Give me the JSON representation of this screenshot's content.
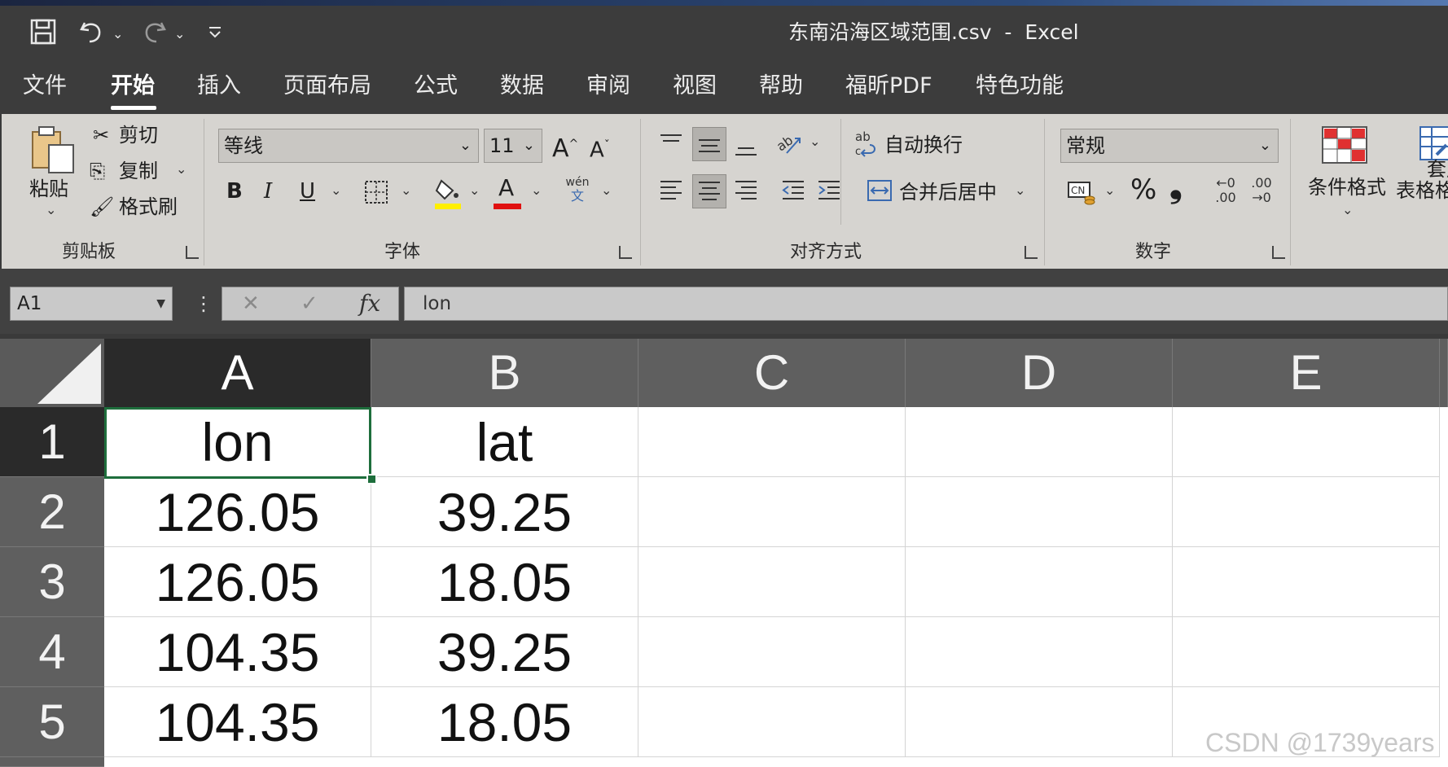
{
  "window": {
    "title": "东南沿海区域范围.csv  -  Excel",
    "quick_access": {
      "save_icon": "save-icon",
      "undo_icon": "undo-icon",
      "redo_icon": "redo-icon",
      "customize_icon": "customize-qat-icon"
    }
  },
  "tabs": [
    {
      "label": "文件",
      "active": false
    },
    {
      "label": "开始",
      "active": true
    },
    {
      "label": "插入",
      "active": false
    },
    {
      "label": "页面布局",
      "active": false
    },
    {
      "label": "公式",
      "active": false
    },
    {
      "label": "数据",
      "active": false
    },
    {
      "label": "审阅",
      "active": false
    },
    {
      "label": "视图",
      "active": false
    },
    {
      "label": "帮助",
      "active": false
    },
    {
      "label": "福昕PDF",
      "active": false
    },
    {
      "label": "特色功能",
      "active": false
    }
  ],
  "ribbon": {
    "clipboard": {
      "group_label": "剪贴板",
      "paste": "粘贴",
      "cut": "剪切",
      "copy": "复制",
      "format_painter": "格式刷"
    },
    "font": {
      "group_label": "字体",
      "font_name": "等线",
      "font_size": "11",
      "bold": "B",
      "italic": "I",
      "underline": "U",
      "grow": "A",
      "shrink": "A",
      "font_color": "A",
      "phonetic": "wén",
      "phonetic_sub": "文",
      "fill_color": "#ffef00",
      "text_color": "#e01010"
    },
    "alignment": {
      "group_label": "对齐方式",
      "wrap_text": "自动换行",
      "merge_center": "合并后居中"
    },
    "number": {
      "group_label": "数字",
      "format": "常规",
      "percent": "%",
      "comma": "❟",
      "inc_decimal_top": "←0",
      "inc_decimal_bottom": ".00",
      "dec_decimal_top": ".00",
      "dec_decimal_bottom": "→0"
    },
    "styles": {
      "conditional_formatting": "条件格式",
      "table_format_top": "套用",
      "table_format_bottom": "表格格"
    }
  },
  "formula_bar": {
    "name_box": "A1",
    "cancel": "✕",
    "enter": "✓",
    "fx": "fx",
    "content": "lon"
  },
  "sheet": {
    "columns": [
      "A",
      "B",
      "C",
      "D",
      "E"
    ],
    "rows": [
      "1",
      "2",
      "3",
      "4",
      "5"
    ],
    "cells": [
      [
        "lon",
        "lat",
        "",
        "",
        ""
      ],
      [
        "126.05",
        "39.25",
        "",
        "",
        ""
      ],
      [
        "126.05",
        "18.05",
        "",
        "",
        ""
      ],
      [
        "104.35",
        "39.25",
        "",
        "",
        ""
      ],
      [
        "104.35",
        "18.05",
        "",
        "",
        ""
      ]
    ],
    "selected_cell": "A1"
  },
  "watermark": "CSDN @1739years"
}
